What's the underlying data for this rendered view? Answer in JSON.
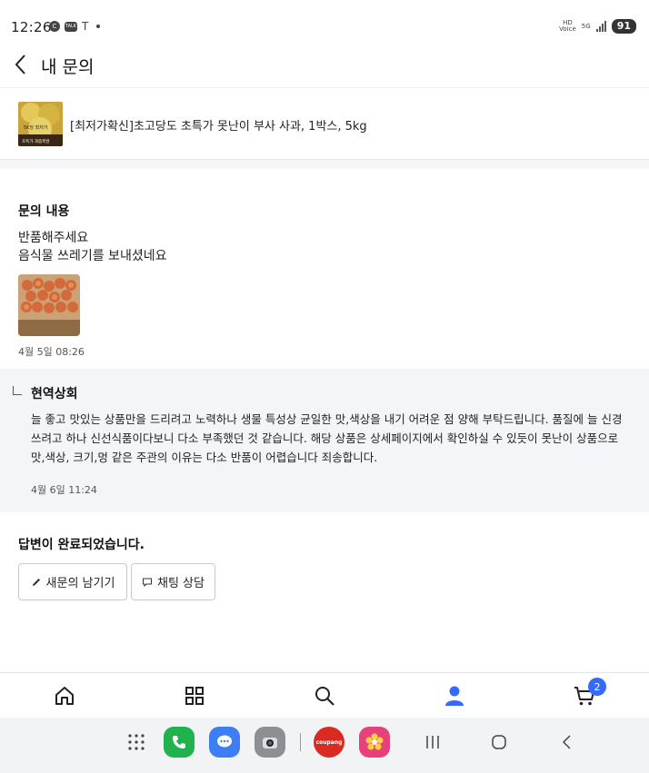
{
  "status_bar": {
    "time": "12:26",
    "left_icons": [
      "c-icon",
      "talk-icon",
      "tesla-icon",
      "dot"
    ],
    "talk_label": "TALK",
    "c_label": "C",
    "hd_label": "HD",
    "voice_label": "Voice",
    "net_label": "5G",
    "battery": "91"
  },
  "header": {
    "title": "내 문의"
  },
  "product": {
    "name": "[최저가확신]초고당도 초특가 못난이 부사 사과, 1박스, 5kg",
    "thumb_caption": "5K당 최저가",
    "thumb_caption2": "초특가 과즙폭발"
  },
  "inquiry": {
    "section_label": "문의 내용",
    "line1": "반품해주세요",
    "line2": "음식물 쓰레기를 보내셨네요",
    "date": "4월 5일 08:26"
  },
  "answer": {
    "seller": "현역상회",
    "body": "늘 좋고 맛있는 상품만을 드리려고 노력하나 생물 특성상 균일한 맛,색상을 내기 어려운 점 양해 부탁드립니다. 품질에 늘 신경 쓰려고 하나 신선식품이다보니 다소 부족했던 것 같습니다. 해당 상품은 상세페이지에서 확인하실 수 있듯이 못난이 상품으로 맛,색상, 크기,멍 같은 주관의 이유는 다소 반품이 어렵습니다 죄송합니다.",
    "date": "4월 6일 11:24"
  },
  "completion": {
    "text": "답변이 완료되었습니다.",
    "new_inquiry_button": "새문의 남기기",
    "chat_button": "채팅 상담"
  },
  "bottom_nav": {
    "items": [
      "home-icon",
      "category-icon",
      "search-icon",
      "my-account-icon",
      "cart-icon"
    ],
    "active": "my-account-icon",
    "cart_count": "2",
    "accent_color": "#346aff"
  },
  "dock": {
    "apps": [
      "apps-grid-icon",
      "phone-app-icon",
      "messages-app-icon",
      "camera-app-icon",
      "coupang-app-icon",
      "flower-app-icon"
    ],
    "coupang_label": "coupang",
    "system_nav": [
      "recents-icon",
      "home-button-icon",
      "back-nav-icon"
    ]
  }
}
